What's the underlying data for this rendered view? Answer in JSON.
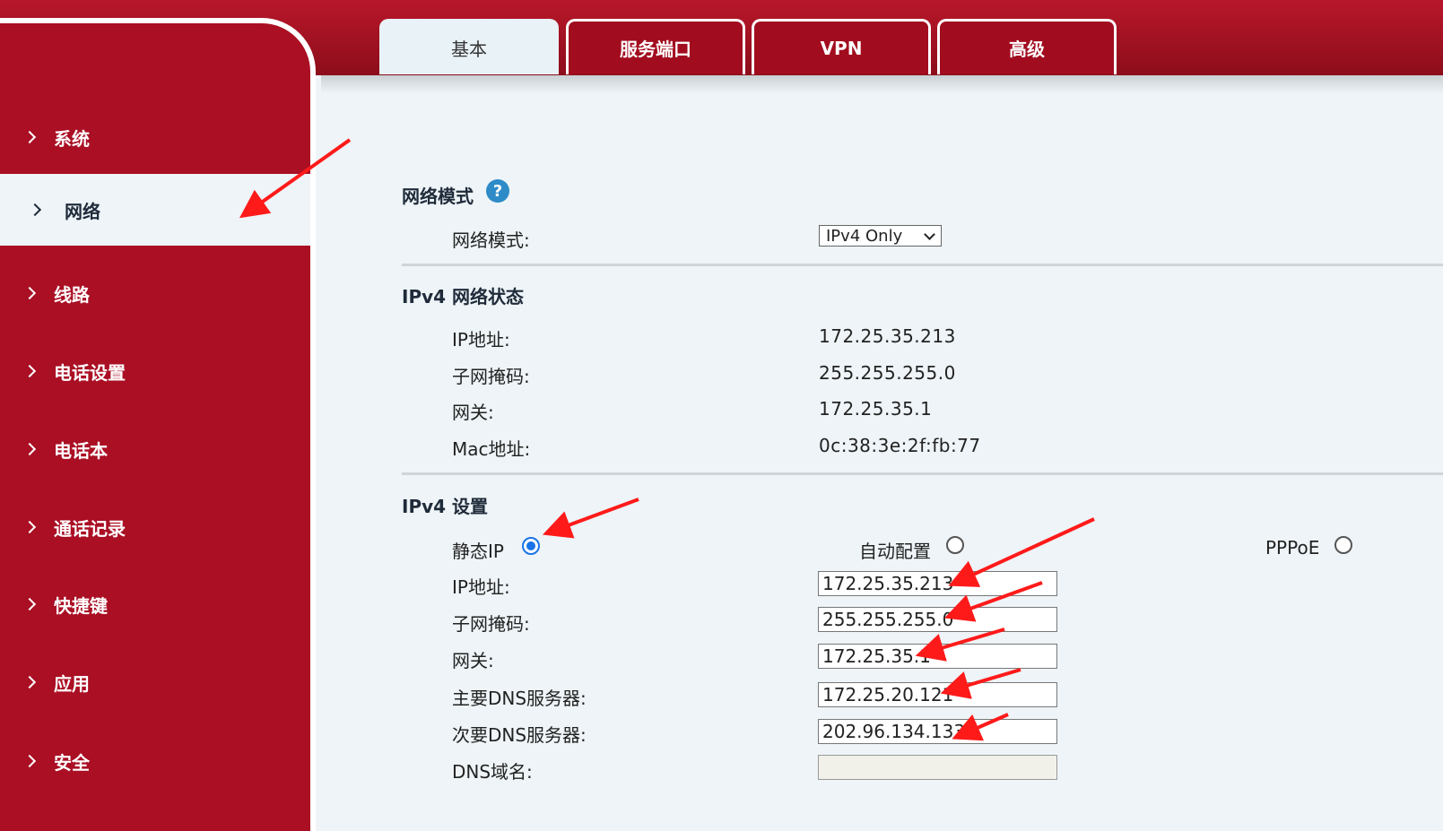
{
  "tabs": [
    {
      "label": "基本",
      "active": true
    },
    {
      "label": "服务端口",
      "active": false
    },
    {
      "label": "VPN",
      "active": false
    },
    {
      "label": "高级",
      "active": false
    }
  ],
  "sidebar": {
    "items": [
      {
        "label": "系统"
      },
      {
        "label": "网络",
        "active": true
      },
      {
        "label": "线路"
      },
      {
        "label": "电话设置"
      },
      {
        "label": "电话本"
      },
      {
        "label": "通话记录"
      },
      {
        "label": "快捷键"
      },
      {
        "label": "应用"
      },
      {
        "label": "安全"
      }
    ]
  },
  "network_mode": {
    "title": "网络模式",
    "help_icon": "question-icon",
    "label": "网络模式:",
    "selected": "IPv4 Only"
  },
  "ipv4_status": {
    "title": "IPv4 网络状态",
    "rows": [
      {
        "label": "IP地址:",
        "value": "172.25.35.213"
      },
      {
        "label": "子网掩码:",
        "value": "255.255.255.0"
      },
      {
        "label": "网关:",
        "value": "172.25.35.1"
      },
      {
        "label": "Mac地址:",
        "value": "0c:38:3e:2f:fb:77"
      }
    ]
  },
  "ipv4_settings": {
    "title": "IPv4 设置",
    "modes": [
      {
        "label": "静态IP",
        "checked": true
      },
      {
        "label": "自动配置",
        "checked": false
      },
      {
        "label": "PPPoE",
        "checked": false
      }
    ],
    "fields": [
      {
        "label": "IP地址:",
        "value": "172.25.35.213"
      },
      {
        "label": "子网掩码:",
        "value": "255.255.255.0"
      },
      {
        "label": "网关:",
        "value": "172.25.35.1"
      },
      {
        "label": "主要DNS服务器:",
        "value": "172.25.20.121"
      },
      {
        "label": "次要DNS服务器:",
        "value": "202.96.134.133"
      },
      {
        "label": "DNS域名:",
        "value": ""
      }
    ]
  },
  "colors": {
    "brand_red": "#aa0f24",
    "annotation_arrow": "#ff1a1a",
    "radio_checked": "#1a73e8"
  }
}
